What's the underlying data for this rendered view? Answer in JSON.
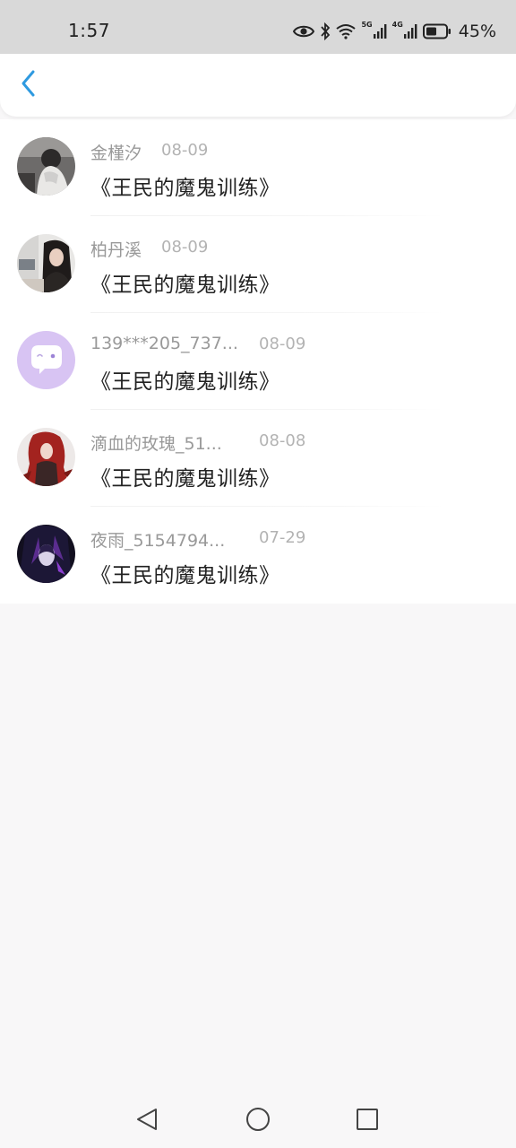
{
  "status_bar": {
    "time": "1:57",
    "network_tag_1": "5G",
    "network_tag_2": "4G",
    "battery_percent": "45%"
  },
  "header": {
    "back_icon": "chevron-left-icon",
    "accent_color": "#2f9ae0"
  },
  "list": {
    "items": [
      {
        "username": "金槿汐",
        "date": "08-09",
        "title": "《王民的魔鬼训练》",
        "avatar": "photo-avatar-girl-white-hoodie"
      },
      {
        "username": "柏丹溪",
        "date": "08-09",
        "title": "《王民的魔鬼训练》",
        "avatar": "photo-avatar-girl-dark-hair"
      },
      {
        "username": "139***205_737...",
        "date": "08-09",
        "title": "《王民的魔鬼训练》",
        "avatar": "default-chat-bubble-avatar"
      },
      {
        "username": "滴血的玫瑰_51...",
        "date": "08-08",
        "title": "《王民的魔鬼训练》",
        "avatar": "photo-avatar-red-hair-character"
      },
      {
        "username": "夜雨_5154794...",
        "date": "07-29",
        "title": "《王民的魔鬼训练》",
        "avatar": "photo-avatar-dark-anime-character"
      }
    ]
  },
  "nav_bar": {
    "back": "triangle-back-icon",
    "home": "circle-home-icon",
    "recents": "square-recents-icon"
  }
}
